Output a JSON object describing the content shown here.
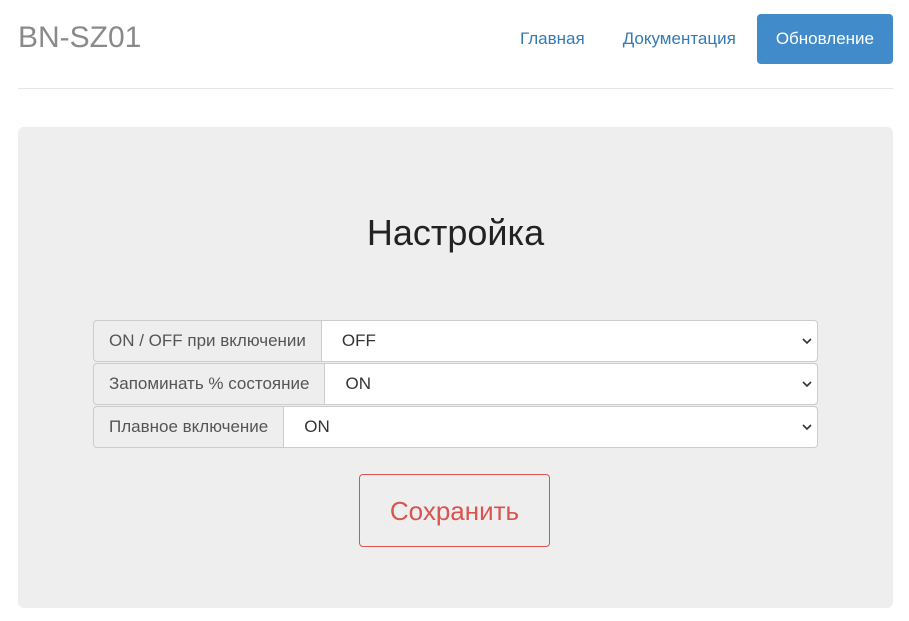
{
  "header": {
    "brand": "BN-SZ01",
    "nav": {
      "home": "Главная",
      "docs": "Документация",
      "update": "Обновление"
    }
  },
  "main": {
    "title": "Настройка",
    "settings": [
      {
        "label": "ON / OFF при включении",
        "value": "OFF"
      },
      {
        "label": "Запоминать % состояние",
        "value": "ON"
      },
      {
        "label": "Плавное включение",
        "value": "ON"
      }
    ],
    "save_label": "Сохранить"
  },
  "colors": {
    "accent": "#428bca",
    "link": "#337ab7",
    "danger": "#d9534f",
    "panel": "#eeeeee"
  },
  "icons": {
    "select_arrow": "chevron-down-icon"
  }
}
